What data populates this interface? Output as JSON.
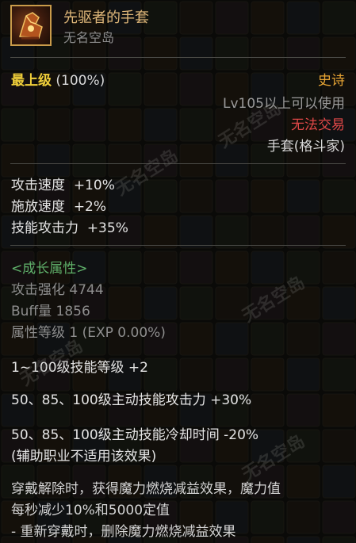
{
  "item": {
    "name": "先驱者的手套",
    "source": "无名空岛",
    "icon": "gauntlet-icon"
  },
  "info": {
    "grade_label": "最上级",
    "grade_percent": "(100%)",
    "rarity": "史诗",
    "level_requirement": "Lv105以上可以使用",
    "trade_status": "无法交易",
    "slot_type": "手套(格斗家)"
  },
  "stats": [
    {
      "name": "攻击速度",
      "value": "+10%"
    },
    {
      "name": "施放速度",
      "value": "+2%"
    },
    {
      "name": "技能攻击力",
      "value": "+35%"
    }
  ],
  "growth": {
    "title": "<成长属性>",
    "attack_boost": "攻击强化 4744",
    "buff_amount": "Buff量 1856",
    "attribute_level": "属性等级 1 (EXP 0.00%)"
  },
  "effects": [
    "1~100级技能等级 +2",
    "50、85、100级主动技能攻击力 +30%",
    "50、85、100级主动技能冷却时间 -20%",
    "(辅助职业不适用该效果)"
  ],
  "special": [
    "穿戴解除时，获得魔力燃烧减益效果，魔力值",
    "每秒减少10%和5000定值",
    "- 重新穿戴时，删除魔力燃烧减益效果"
  ],
  "watermark": "无名空岛",
  "colors": {
    "item_name": "#e0b87a",
    "grade": "#f0cf3a",
    "rarity": "#e8a534",
    "trade": "#e04848",
    "growth_title": "#5fb06a"
  }
}
